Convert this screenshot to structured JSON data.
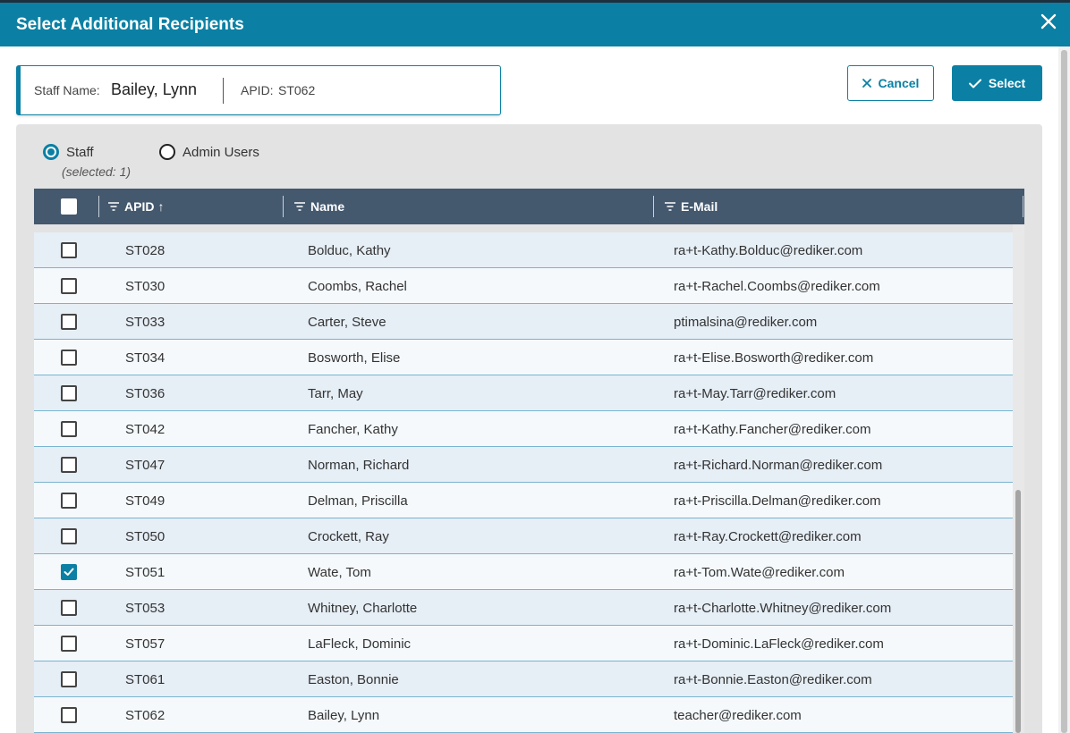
{
  "dialog": {
    "title": "Select Additional Recipients"
  },
  "staff_card": {
    "name_label": "Staff Name:",
    "name_value": "Bailey, Lynn",
    "apid_label": "APID:",
    "apid_value": "ST062"
  },
  "actions": {
    "cancel_label": "Cancel",
    "select_label": "Select"
  },
  "filter": {
    "options": [
      {
        "label": "Staff",
        "checked": true
      },
      {
        "label": "Admin Users",
        "checked": false
      }
    ],
    "selected_note": "(selected: 1)"
  },
  "grid": {
    "columns": [
      {
        "label": "APID",
        "sort": "↑"
      },
      {
        "label": "Name"
      },
      {
        "label": "E-Mail"
      }
    ],
    "rows": [
      {
        "apid": "ST028",
        "name": "Bolduc, Kathy",
        "email": "ra+t-Kathy.Bolduc@rediker.com",
        "checked": false
      },
      {
        "apid": "ST030",
        "name": "Coombs, Rachel",
        "email": "ra+t-Rachel.Coombs@rediker.com",
        "checked": false
      },
      {
        "apid": "ST033",
        "name": "Carter, Steve",
        "email": "ptimalsina@rediker.com",
        "checked": false
      },
      {
        "apid": "ST034",
        "name": "Bosworth, Elise",
        "email": "ra+t-Elise.Bosworth@rediker.com",
        "checked": false
      },
      {
        "apid": "ST036",
        "name": "Tarr, May",
        "email": "ra+t-May.Tarr@rediker.com",
        "checked": false
      },
      {
        "apid": "ST042",
        "name": "Fancher, Kathy",
        "email": "ra+t-Kathy.Fancher@rediker.com",
        "checked": false
      },
      {
        "apid": "ST047",
        "name": "Norman, Richard",
        "email": "ra+t-Richard.Norman@rediker.com",
        "checked": false
      },
      {
        "apid": "ST049",
        "name": "Delman, Priscilla",
        "email": "ra+t-Priscilla.Delman@rediker.com",
        "checked": false
      },
      {
        "apid": "ST050",
        "name": "Crockett, Ray",
        "email": "ra+t-Ray.Crockett@rediker.com",
        "checked": false
      },
      {
        "apid": "ST051",
        "name": "Wate, Tom",
        "email": "ra+t-Tom.Wate@rediker.com",
        "checked": true
      },
      {
        "apid": "ST053",
        "name": "Whitney, Charlotte",
        "email": "ra+t-Charlotte.Whitney@rediker.com",
        "checked": false
      },
      {
        "apid": "ST057",
        "name": "LaFleck, Dominic",
        "email": "ra+t-Dominic.LaFleck@rediker.com",
        "checked": false
      },
      {
        "apid": "ST061",
        "name": "Easton, Bonnie",
        "email": "ra+t-Bonnie.Easton@rediker.com",
        "checked": false
      },
      {
        "apid": "ST062",
        "name": "Bailey, Lynn",
        "email": "teacher@rediker.com",
        "checked": false
      }
    ]
  },
  "colors": {
    "accent": "#0b80a4",
    "header_bg": "#44586e",
    "row_odd": "#e6eef6",
    "row_even": "#f5f9fc"
  },
  "icons": {
    "close": "close-icon",
    "cancel": "x-icon",
    "select": "checkmark-icon",
    "filter": "filter-icon",
    "sort": "sort-ascending-icon"
  }
}
